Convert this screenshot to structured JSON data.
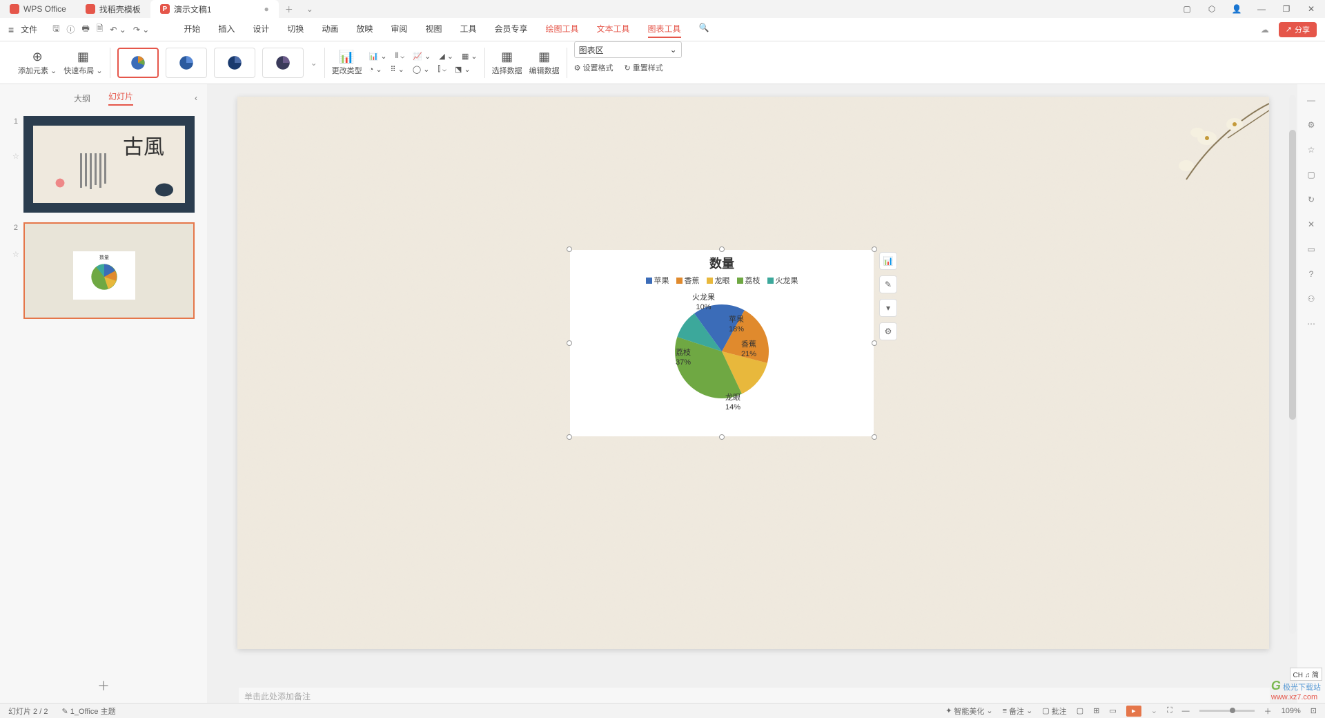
{
  "titlebar": {
    "tab_home": "WPS Office",
    "tab_templates": "找稻壳模板",
    "tab_doc": "演示文稿1",
    "dirty": "●"
  },
  "menubar": {
    "file": "文件",
    "tabs": [
      "开始",
      "插入",
      "设计",
      "切换",
      "动画",
      "放映",
      "审阅",
      "视图",
      "工具",
      "会员专享",
      "绘图工具",
      "文本工具",
      "图表工具"
    ],
    "share": "分享"
  },
  "ribbon": {
    "add_element": "添加元素",
    "quick_layout": "快速布局",
    "change_type": "更改类型",
    "select_data": "选择数据",
    "edit_data": "编辑数据",
    "combo_value": "图表区",
    "set_format": "设置格式",
    "reset_style": "重置样式"
  },
  "leftpanel": {
    "tab_outline": "大纲",
    "tab_slides": "幻灯片",
    "slide1_num": "1",
    "slide2_num": "2",
    "slide1_title": "古風"
  },
  "chart_data": {
    "type": "pie",
    "title": "数量",
    "series": [
      {
        "name": "苹果",
        "value": 18,
        "color": "#3b6cb8"
      },
      {
        "name": "香蕉",
        "value": 21,
        "color": "#e08a2d"
      },
      {
        "name": "龙眼",
        "value": 14,
        "color": "#e8b83c"
      },
      {
        "name": "荔枝",
        "value": 37,
        "color": "#6fa843"
      },
      {
        "name": "火龙果",
        "value": 10,
        "color": "#3ca89b"
      }
    ],
    "labels": {
      "apple": "苹果\n18%",
      "banana": "香蕉\n21%",
      "longan": "龙眼\n14%",
      "lychee": "荔枝\n37%",
      "dragon": "火龙果\n10%"
    }
  },
  "notes_placeholder": "单击此处添加备注",
  "statusbar": {
    "page": "幻灯片 2 / 2",
    "theme": "1_Office 主题",
    "beautify": "智能美化",
    "notes": "备注",
    "comments": "批注",
    "zoom": "109%"
  },
  "ime": "CH ♫ 简",
  "watermark_text": "极光下载站",
  "watermark_url": "www.xz7.com"
}
